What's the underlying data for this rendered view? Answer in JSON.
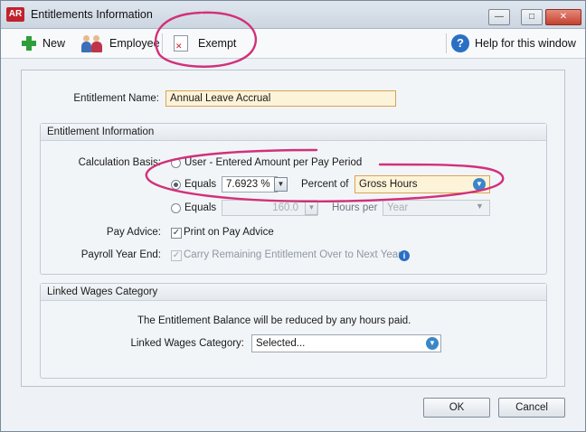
{
  "window": {
    "title": "Entitlements Information",
    "app_badge": "AR",
    "minimize_glyph": "—",
    "maximize_glyph": "□",
    "close_glyph": "✕"
  },
  "toolbar": {
    "new_label": "New",
    "employee_label": "Employee",
    "exempt_label": "Exempt",
    "help_label": "Help for this window",
    "help_glyph": "?"
  },
  "form": {
    "entitlement_name_label": "Entitlement Name:",
    "entitlement_name_value": "Annual Leave Accrual",
    "entitlement_info": {
      "header": "Entitlement Information",
      "calc_basis_label": "Calculation Basis:",
      "option_user": "User - Entered Amount per Pay Period",
      "option_equals": "Equals",
      "percent_value": "7.6923 %",
      "percent_of_label": "Percent of",
      "percent_of_value": "Gross Hours",
      "option_equals2": "Equals",
      "hours_value": "160.0",
      "hours_per_label": "Hours per",
      "hours_per_value": "Year",
      "pay_advice_label": "Pay Advice:",
      "print_on_pay_advice": "Print on Pay Advice",
      "payroll_year_end_label": "Payroll Year End:",
      "carry_remaining": "Carry Remaining Entitlement Over to Next Year",
      "info_glyph": "i"
    },
    "linked_wages": {
      "header": "Linked Wages Category",
      "note": "The Entitlement Balance will be reduced by any hours paid.",
      "linked_label": "Linked Wages Category:",
      "linked_value": "Selected..."
    }
  },
  "buttons": {
    "ok": "OK",
    "cancel": "Cancel"
  },
  "glyphs": {
    "check": "✓",
    "spin_down": "▼",
    "combo_down": "▼"
  },
  "state": {
    "calc_basis_selected": "equals_percent",
    "print_on_pay_advice": true,
    "carry_remaining": true,
    "carry_remaining_disabled": true
  },
  "colors": {
    "annotation": "#d1317a",
    "highlight_field": "#fdf3d8",
    "accent": "#2b6fc4",
    "close_button": "#c4422f"
  }
}
